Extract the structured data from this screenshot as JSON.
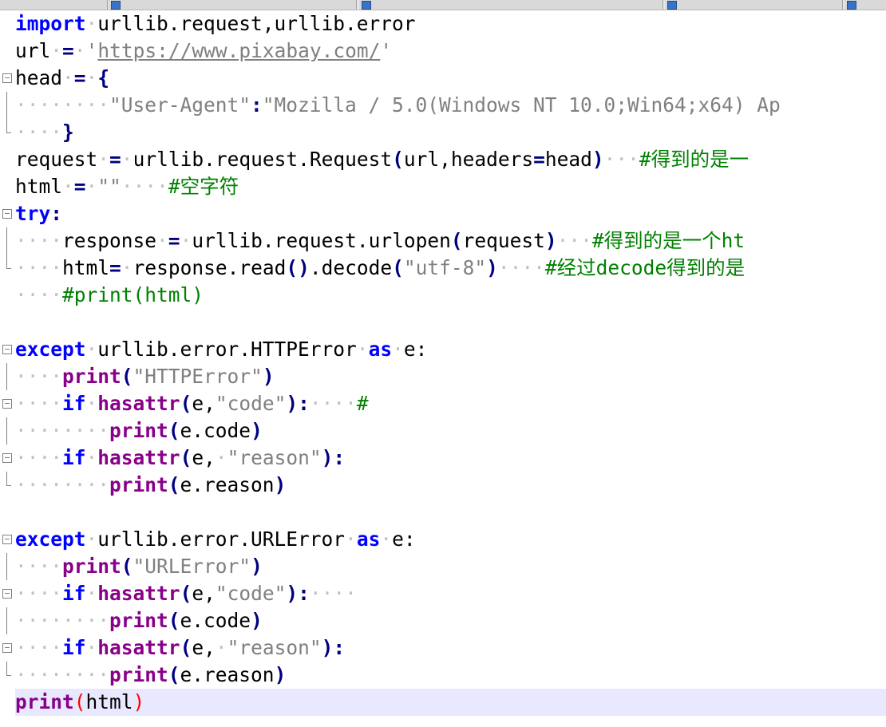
{
  "code": {
    "l1_kw": "import",
    "l1_rest": "urllib.request,urllib.error",
    "l2_var": "url",
    "l2_op": "=",
    "l2_q1": "'",
    "l2_url": "https://www.pixabay.com/",
    "l2_q2": "'",
    "l3_var": "head",
    "l3_op": "=",
    "l3_brace": "{",
    "l4_key": "\"User-Agent\"",
    "l4_colon": ":",
    "l4_val": "\"Mozilla / 5.0(Windows NT 10.0;Win64;x64) Ap",
    "l5_brace": "}",
    "l6_var": "request",
    "l6_op": "=",
    "l6_call": "urllib.request.Request",
    "l6_p1": "(",
    "l6_args1": "url,headers",
    "l6_eq": "=",
    "l6_args2": "head",
    "l6_p2": ")",
    "l6_cmt": "#得到的是一",
    "l7_var": "html",
    "l7_op": "=",
    "l7_str": "\"\"",
    "l7_cmt": "#空字符",
    "l8_kw": "try",
    "l8_colon": ":",
    "l9_var": "response",
    "l9_op": "=",
    "l9_call": "urllib.request.urlopen",
    "l9_p1": "(",
    "l9_arg": "request",
    "l9_p2": ")",
    "l9_cmt": "#得到的是一个ht",
    "l10_var": "html",
    "l10_op": "=",
    "l10_call": "response.read",
    "l10_p": "()",
    "l10_dot": ".decode",
    "l10_p1": "(",
    "l10_str": "\"utf-8\"",
    "l10_p2": ")",
    "l10_cmt": "#经过decode得到的是",
    "l11_cmt": "#print(html)",
    "l13_kw": "except",
    "l13_rest": "urllib.error.HTTPError",
    "l13_as": "as",
    "l13_e": "e:",
    "l14_fn": "print",
    "l14_p1": "(",
    "l14_str": "\"HTTPError\"",
    "l14_p2": ")",
    "l15_if": "if",
    "l15_fn": "hasattr",
    "l15_p1": "(",
    "l15_e": "e,",
    "l15_str": "\"code\"",
    "l15_p2": "):",
    "l15_cmt": "#",
    "l16_fn": "print",
    "l16_p1": "(",
    "l16_arg": "e.code",
    "l16_p2": ")",
    "l17_if": "if",
    "l17_fn": "hasattr",
    "l17_p1": "(",
    "l17_e": "e,",
    "l17_str": "\"reason\"",
    "l17_p2": "):",
    "l18_fn": "print",
    "l18_p1": "(",
    "l18_arg": "e.reason",
    "l18_p2": ")",
    "l20_kw": "except",
    "l20_rest": "urllib.error.URLError",
    "l20_as": "as",
    "l20_e": "e:",
    "l21_fn": "print",
    "l21_p1": "(",
    "l21_str": "\"URLError\"",
    "l21_p2": ")",
    "l22_if": "if",
    "l22_fn": "hasattr",
    "l22_p1": "(",
    "l22_e": "e,",
    "l22_str": "\"code\"",
    "l22_p2": "):",
    "l23_fn": "print",
    "l23_p1": "(",
    "l23_arg": "e.code",
    "l23_p2": ")",
    "l24_if": "if",
    "l24_fn": "hasattr",
    "l24_p1": "(",
    "l24_e": "e,",
    "l24_str": "\"reason\"",
    "l24_p2": "):",
    "l25_fn": "print",
    "l25_p1": "(",
    "l25_arg": "e.reason",
    "l25_p2": ")",
    "l26_fn": "print",
    "l26_p1": "(",
    "l26_arg": "html",
    "l26_p2": ")"
  },
  "colors": {
    "keyword": "#0000ff",
    "builtin": "#880088",
    "operator": "#000080",
    "string": "#808080",
    "comment": "#008000",
    "current_line": "#e8e8ff"
  },
  "icons": [
    "fold-box-icon",
    "tab-file-icon"
  ]
}
